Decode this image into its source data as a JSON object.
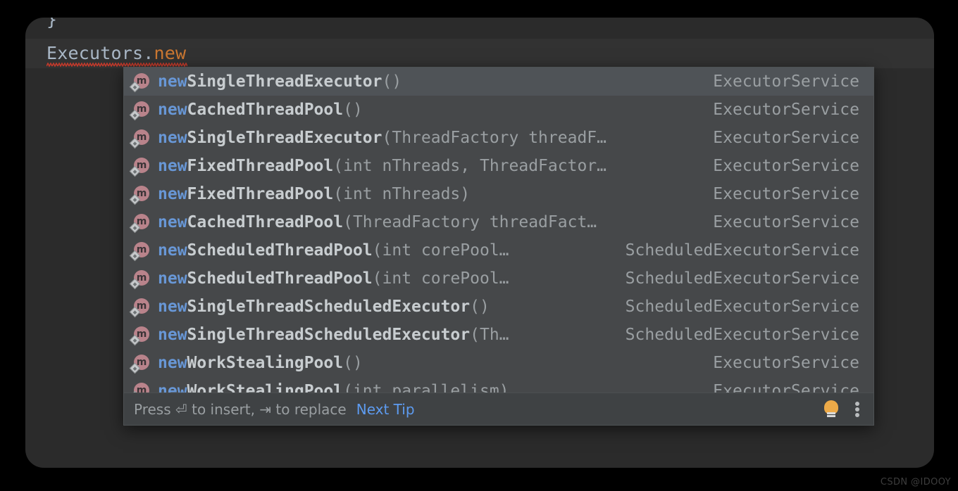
{
  "editor": {
    "previous_line_fragment": "}",
    "code_line": {
      "identifier": "Executors",
      "separator": ".",
      "keyword": "new"
    },
    "background_color": "#2b2b2b",
    "caret_line_color": "#323232",
    "error_underline_color": "#c0392b"
  },
  "completion_popup": {
    "background_color": "#46484a",
    "selected_row_color": "#4f5357",
    "prefix_match_color": "#6897d6",
    "item_icon_name": "method-icon",
    "items": [
      {
        "icon": "method-icon",
        "prefix": "new",
        "name": "SingleThreadExecutor",
        "params": "()",
        "type": "ExecutorService",
        "selected": true
      },
      {
        "icon": "method-icon",
        "prefix": "new",
        "name": "CachedThreadPool",
        "params": "()",
        "type": "ExecutorService",
        "selected": false
      },
      {
        "icon": "method-icon",
        "prefix": "new",
        "name": "SingleThreadExecutor",
        "params": "(ThreadFactory threadF…",
        "type": "ExecutorService",
        "selected": false
      },
      {
        "icon": "method-icon",
        "prefix": "new",
        "name": "FixedThreadPool",
        "params": "(int nThreads, ThreadFactor…",
        "type": "ExecutorService",
        "selected": false
      },
      {
        "icon": "method-icon",
        "prefix": "new",
        "name": "FixedThreadPool",
        "params": "(int nThreads)",
        "type": "ExecutorService",
        "selected": false
      },
      {
        "icon": "method-icon",
        "prefix": "new",
        "name": "CachedThreadPool",
        "params": "(ThreadFactory threadFact…",
        "type": "ExecutorService",
        "selected": false
      },
      {
        "icon": "method-icon",
        "prefix": "new",
        "name": "ScheduledThreadPool",
        "params": "(int corePool…",
        "type": "ScheduledExecutorService",
        "selected": false
      },
      {
        "icon": "method-icon",
        "prefix": "new",
        "name": "ScheduledThreadPool",
        "params": "(int corePool…",
        "type": "ScheduledExecutorService",
        "selected": false
      },
      {
        "icon": "method-icon",
        "prefix": "new",
        "name": "SingleThreadScheduledExecutor",
        "params": "()",
        "type": "ScheduledExecutorService",
        "selected": false
      },
      {
        "icon": "method-icon",
        "prefix": "new",
        "name": "SingleThreadScheduledExecutor",
        "params": "(Th…",
        "type": "ScheduledExecutorService",
        "selected": false
      },
      {
        "icon": "method-icon",
        "prefix": "new",
        "name": "WorkStealingPool",
        "params": "()",
        "type": "ExecutorService",
        "selected": false
      },
      {
        "icon": "method-icon",
        "prefix": "new",
        "name": "WorkStealingPool",
        "params": "(int parallelism)",
        "type": "ExecutorService",
        "selected": false
      }
    ],
    "statusbar": {
      "hint_text": "Press ⏎ to insert, ⇥ to replace",
      "next_tip_label": "Next Tip",
      "bulb_icon_name": "lightbulb-icon",
      "bulb_color": "#edaa48",
      "kebab_icon_name": "more-options-icon"
    }
  },
  "watermark": {
    "text": "CSDN @IDOOY"
  }
}
